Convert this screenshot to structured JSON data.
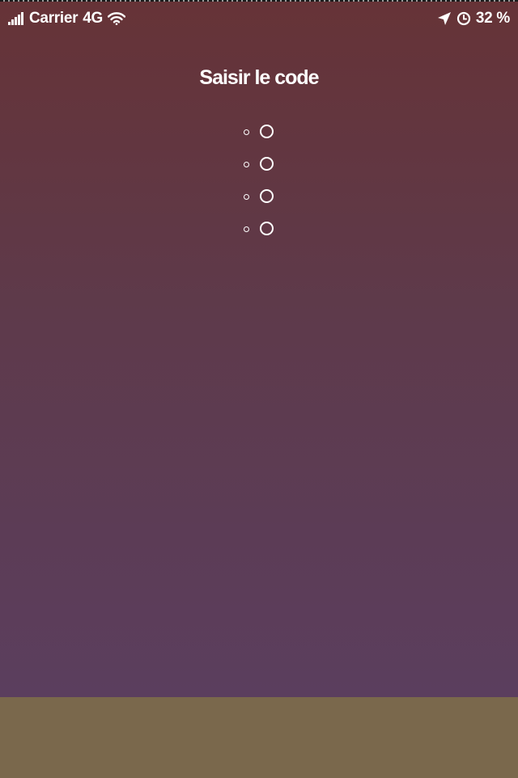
{
  "status_bar": {
    "carrier": "Carrier",
    "network": "4G",
    "battery": "32 %"
  },
  "title": "Saisir le code",
  "code": {
    "digits_entered": 0,
    "total_digits": 4,
    "slots": [
      {
        "filled": false
      },
      {
        "filled": false
      },
      {
        "filled": false
      },
      {
        "filled": false
      }
    ]
  },
  "colors": {
    "gradient_top": "#663337",
    "gradient_bottom": "#5b3e5e",
    "bottom_area": "#7a684c",
    "text": "#ffffff"
  },
  "icons": [
    "signal-icon",
    "wifi-icon",
    "location-icon",
    "alarm-icon"
  ]
}
